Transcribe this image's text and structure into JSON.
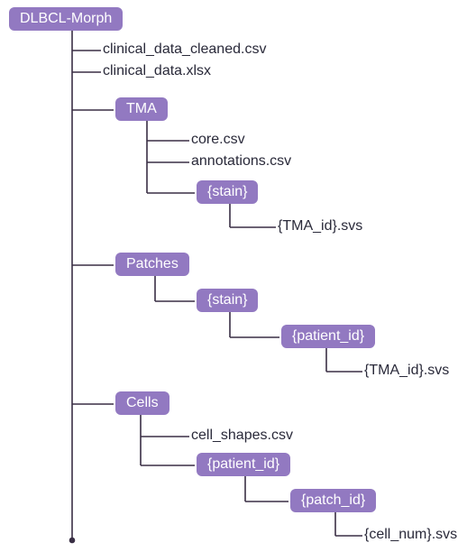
{
  "root": {
    "label": "DLBCL-Morph"
  },
  "level1_files": {
    "f1": "clinical_data_cleaned.csv",
    "f2": "clinical_data.xlsx"
  },
  "tma": {
    "label": "TMA",
    "files": {
      "f1": "core.csv",
      "f2": "annotations.csv"
    },
    "stain": {
      "label": "{stain}",
      "leaf": "{TMA_id}.svs"
    }
  },
  "patches": {
    "label": "Patches",
    "stain": {
      "label": "{stain}",
      "patient": {
        "label": "{patient_id}",
        "leaf": "{TMA_id}.svs"
      }
    }
  },
  "cells": {
    "label": "Cells",
    "file": "cell_shapes.csv",
    "patient": {
      "label": "{patient_id}",
      "patch": {
        "label": "{patch_id}",
        "leaf": "{cell_num}.svs"
      }
    }
  }
}
